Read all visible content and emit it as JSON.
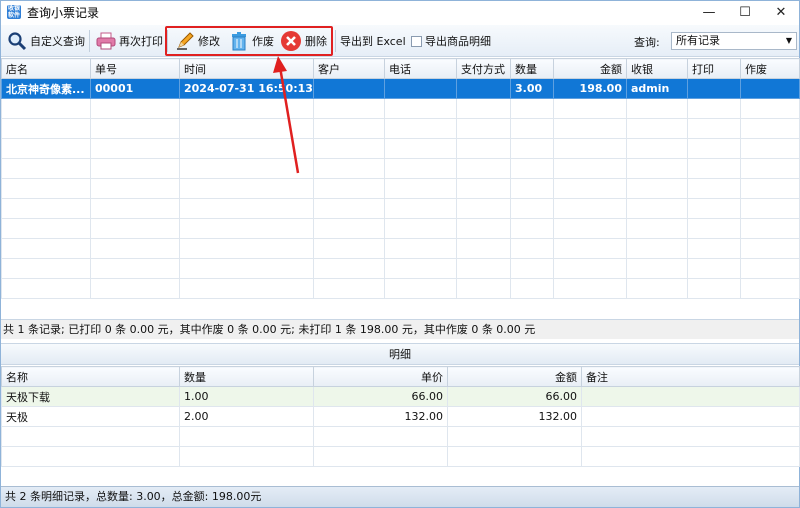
{
  "window": {
    "title": "查询小票记录",
    "app_icon_text": "收银软件",
    "minimize": "—",
    "maximize": "☐",
    "close": "✕"
  },
  "toolbar": {
    "custom_query": "自定义查询",
    "reprint": "再次打印",
    "edit": "修改",
    "void": "作废",
    "delete": "删除",
    "export_excel": "导出到 Excel",
    "export_details": "导出商品明细",
    "query_label": "查询:",
    "query_value": "所有记录",
    "highlight_color": "#e02020"
  },
  "receipts": {
    "columns": [
      "店名",
      "单号",
      "时间",
      "客户",
      "电话",
      "支付方式",
      "数量",
      "金额",
      "收银",
      "打印",
      "作废"
    ],
    "rows": [
      {
        "store": "北京神奇像素...",
        "number": "00001",
        "time": "2024-07-31 16:50:13",
        "customer": "",
        "phone": "",
        "payment": "",
        "qty": "3.00",
        "amount": "198.00",
        "cashier": "admin",
        "printed": "",
        "voided": ""
      }
    ]
  },
  "summary": "共 1 条记录;  已打印 0 条 0.00 元，其中作废 0 条 0.00 元;   未打印 1 条 198.00 元，其中作废 0 条 0.00 元",
  "details": {
    "title": "明细",
    "columns": [
      "名称",
      "数量",
      "单价",
      "金额",
      "备注"
    ],
    "rows": [
      {
        "name": "天极下载",
        "qty": "1.00",
        "price": "66.00",
        "amount": "66.00",
        "note": ""
      },
      {
        "name": "天极",
        "qty": "2.00",
        "price": "132.00",
        "amount": "132.00",
        "note": ""
      }
    ]
  },
  "status": "共 2 条明细记录，总数量: 3.00，总金额: 198.00元",
  "colors": {
    "selection": "#1177d6",
    "accent": "#2f7fd7",
    "annotation": "#e02020"
  }
}
